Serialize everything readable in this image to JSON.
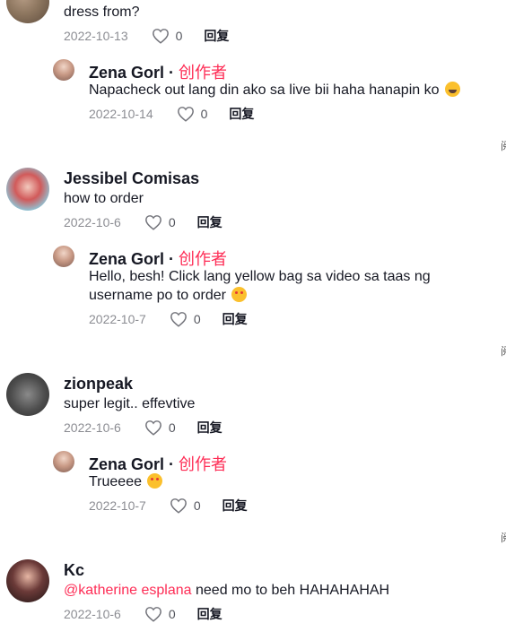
{
  "owner_name": "Zena Gorl",
  "creator_badge": "创作者",
  "reply_label": "回复",
  "icons": {
    "like": "heart-outline-icon",
    "edge_marker": "cut-off-glyph"
  },
  "comments": [
    {
      "id": "c0",
      "text": "dress from?",
      "date": "2022-10-13",
      "likes": "0",
      "replies": [
        {
          "text": "Napacheck out lang din ako sa live bii haha hanapin ko",
          "date": "2022-10-14",
          "likes": "0",
          "emoji": "grinning-squinting-face"
        }
      ]
    },
    {
      "id": "c1",
      "user": "Jessibel Comisas",
      "text": "how to order",
      "date": "2022-10-6",
      "likes": "0",
      "replies": [
        {
          "text_line1": "Hello, besh! Click lang yellow bag sa video sa taas ng",
          "text_line2": "username po to order",
          "date": "2022-10-7",
          "likes": "0",
          "emoji": "smiling-face-with-hearts"
        }
      ]
    },
    {
      "id": "c2",
      "user": "zionpeak",
      "text": "super legit.. effevtive",
      "date": "2022-10-6",
      "likes": "0",
      "replies": [
        {
          "text": "Trueeee",
          "date": "2022-10-7",
          "likes": "0",
          "emoji": "smiling-face-with-hearts"
        }
      ]
    },
    {
      "id": "c3",
      "user": "Kc",
      "mention": "@katherine esplana",
      "text": " need mo to beh HAHAHAHAH",
      "date": "2022-10-6",
      "likes": "0"
    }
  ],
  "edge_glyph": "阅"
}
